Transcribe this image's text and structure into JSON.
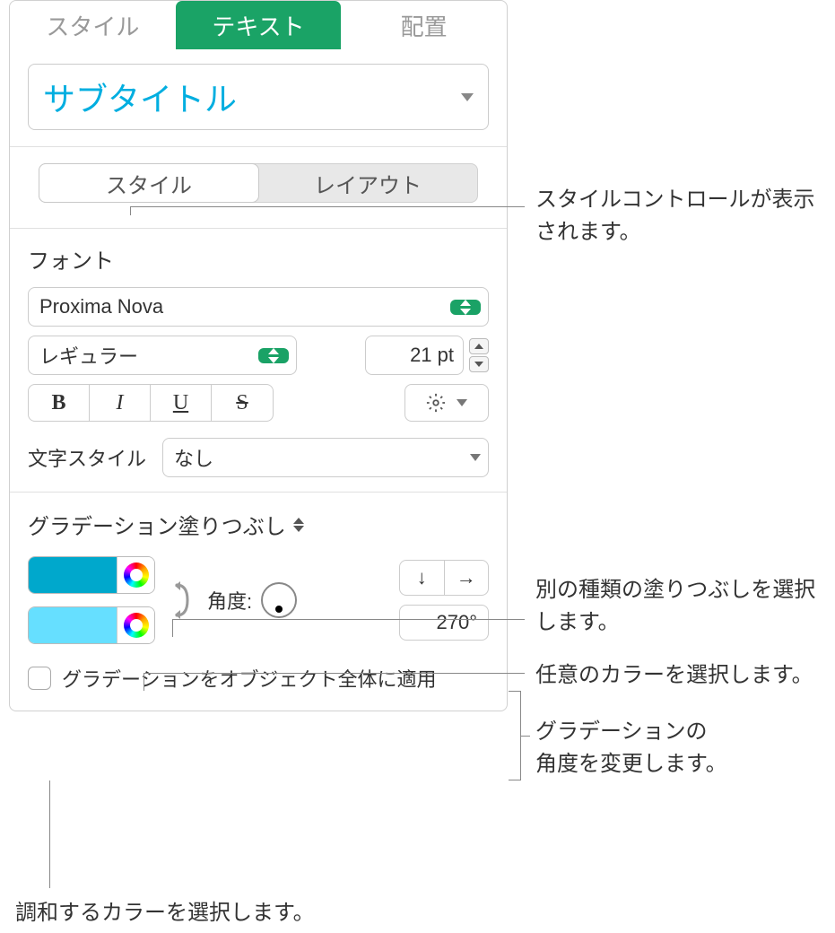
{
  "tabs": {
    "style": "スタイル",
    "text": "テキスト",
    "arrange": "配置"
  },
  "paragraph_style": "サブタイトル",
  "sub_tabs": {
    "style": "スタイル",
    "layout": "レイアウト"
  },
  "font": {
    "section_label": "フォント",
    "family": "Proxima Nova",
    "weight": "レギュラー",
    "size": "21 pt",
    "char_style_label": "文字スタイル",
    "char_style_value": "なし"
  },
  "fill": {
    "header": "グラデーション塗りつぶし",
    "angle_label": "角度:",
    "angle_value": "270°",
    "apply_overall": "グラデーションをオブジェクト全体に適用"
  },
  "callouts": {
    "c1": "スタイルコントロールが表示されます。",
    "c2": "別の種類の塗りつぶしを選択します。",
    "c3": "任意のカラーを選択します。",
    "c4_a": "グラデーションの",
    "c4_b": "角度を変更します。",
    "c5": "調和するカラーを選択します。"
  }
}
